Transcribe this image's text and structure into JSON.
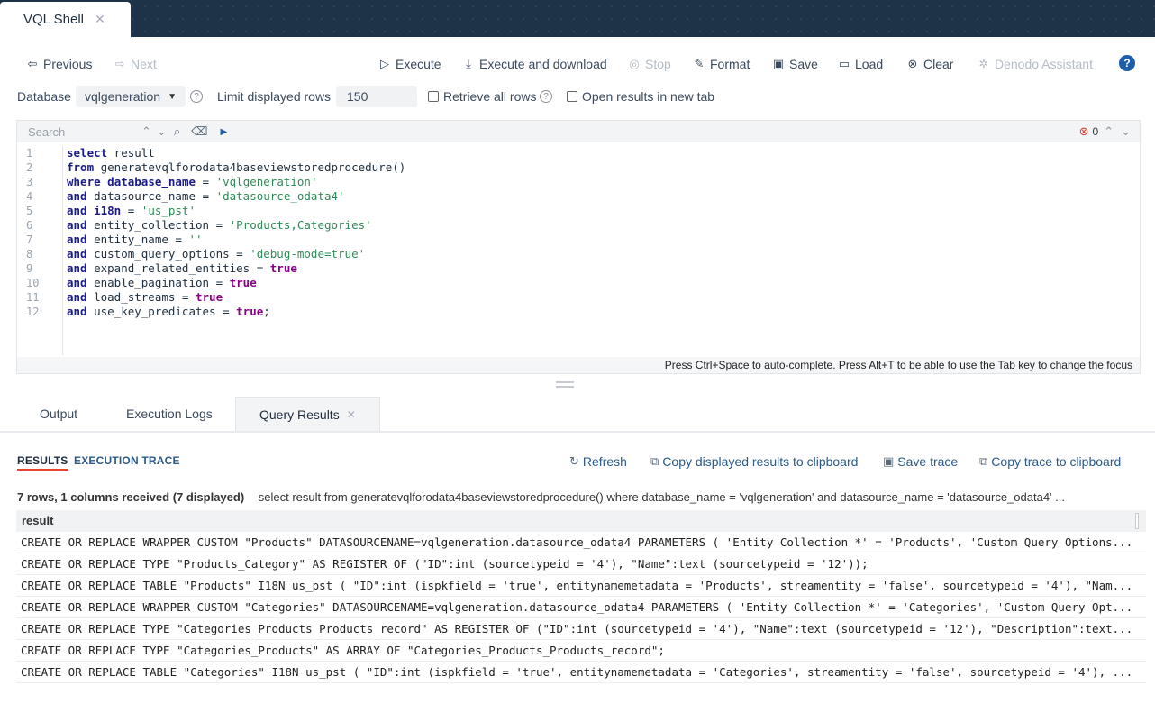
{
  "window": {
    "tab_title": "VQL Shell",
    "close_glyph": "✕"
  },
  "toolbar": {
    "previous": "Previous",
    "next": "Next",
    "execute": "Execute",
    "execute_download": "Execute and download",
    "stop": "Stop",
    "format": "Format",
    "save": "Save",
    "load": "Load",
    "clear": "Clear",
    "assistant": "Denodo Assistant",
    "help": "?"
  },
  "options": {
    "database_label": "Database",
    "database_value": "vqlgeneration",
    "limit_label": "Limit displayed rows",
    "limit_value": "150",
    "retrieve_all": "Retrieve all rows",
    "open_new_tab": "Open results in new tab"
  },
  "editor": {
    "search_placeholder": "Search",
    "error_count": "0",
    "hint": "Press Ctrl+Space to auto-complete. Press Alt+T to be able to use the Tab key to change the focus",
    "lines": [
      "1",
      "2",
      "3",
      "4",
      "5",
      "6",
      "7",
      "8",
      "9",
      "10",
      "11",
      "12"
    ]
  },
  "bottom_tabs": {
    "output": "Output",
    "logs": "Execution Logs",
    "results": "Query Results"
  },
  "results": {
    "tab_results": "RESULTS",
    "tab_trace": "EXECUTION TRACE",
    "refresh": "Refresh",
    "copy_displayed": "Copy displayed results to clipboard",
    "save_trace": "Save trace",
    "copy_trace": "Copy trace to clipboard",
    "count": "7 rows, 1 columns received (7 displayed)",
    "query": "select result from generatevqlforodata4baseviewstoredprocedure() where database_name = 'vqlgeneration' and datasource_name = 'datasource_odata4' ...",
    "column": "result",
    "rows": [
      "CREATE OR REPLACE WRAPPER CUSTOM \"Products\" DATASOURCENAME=vqlgeneration.datasource_odata4 PARAMETERS ( 'Entity Collection *' = 'Products', 'Custom Query Options...",
      "CREATE OR REPLACE TYPE \"Products_Category\" AS REGISTER OF (\"ID\":int (sourcetypeid = '4'), \"Name\":text (sourcetypeid = '12'));",
      "CREATE OR REPLACE TABLE \"Products\" I18N us_pst ( \"ID\":int (ispkfield = 'true', entitynamemetadata = 'Products', streamentity = 'false', sourcetypeid = '4'), \"Nam...",
      "CREATE OR REPLACE WRAPPER CUSTOM \"Categories\" DATASOURCENAME=vqlgeneration.datasource_odata4 PARAMETERS ( 'Entity Collection *' = 'Categories', 'Custom Query Opt...",
      "CREATE OR REPLACE TYPE \"Categories_Products_Products_record\" AS REGISTER OF (\"ID\":int (sourcetypeid = '4'), \"Name\":text (sourcetypeid = '12'), \"Description\":text...",
      "CREATE OR REPLACE TYPE \"Categories_Products\" AS ARRAY OF \"Categories_Products_Products_record\";",
      "CREATE OR REPLACE TABLE \"Categories\" I18N us_pst ( \"ID\":int (ispkfield = 'true', entitynamemetadata = 'Categories', streamentity = 'false', sourcetypeid = '4'), ..."
    ]
  }
}
